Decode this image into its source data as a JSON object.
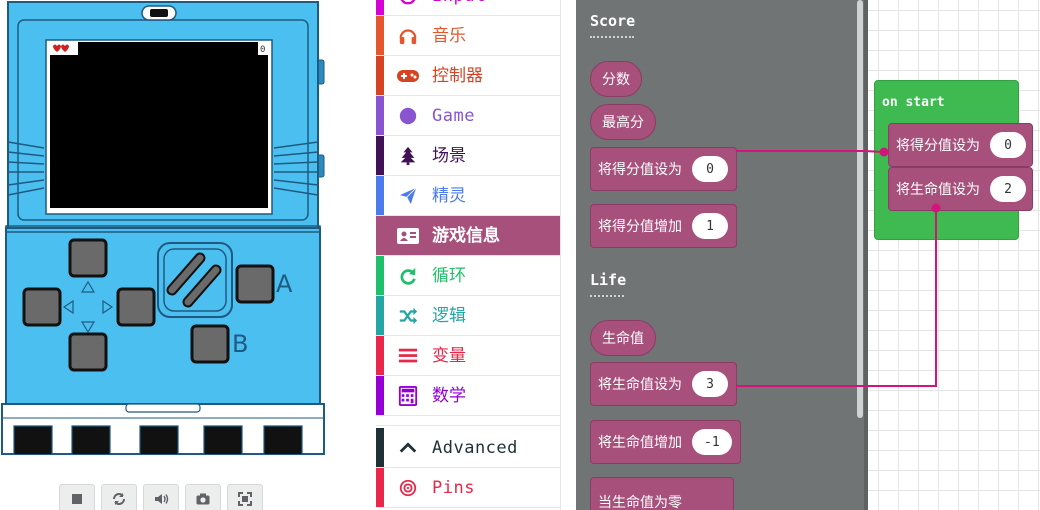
{
  "simulator": {
    "score_icon": "hearts-icon",
    "button_a_label": "A",
    "button_b_label": "B",
    "controls": [
      {
        "name": "stop-button",
        "icon": "stop-icon"
      },
      {
        "name": "restart-button",
        "icon": "restart-icon"
      },
      {
        "name": "mute-button",
        "icon": "speaker-icon"
      },
      {
        "name": "screenshot-button",
        "icon": "camera-icon"
      },
      {
        "name": "fullscreen-button",
        "icon": "fullscreen-icon"
      }
    ]
  },
  "toolbox": {
    "categories": [
      {
        "label": "Input",
        "color": "#d400d4",
        "icon": "input-icon"
      },
      {
        "label": "音乐",
        "color": "#e4572e",
        "icon": "headphones-icon"
      },
      {
        "label": "控制器",
        "color": "#d54322",
        "icon": "gamepad-icon"
      },
      {
        "label": "Game",
        "color": "#8854d0",
        "icon": "circle-icon"
      },
      {
        "label": "场景",
        "color": "#401255",
        "icon": "tree-icon"
      },
      {
        "label": "精灵",
        "color": "#4b7bec",
        "icon": "paper-plane-icon"
      },
      {
        "label": "游戏信息",
        "color": "#a8507c",
        "icon": "id-card-icon",
        "selected": true
      },
      {
        "label": "循环",
        "color": "#20bf6b",
        "icon": "loop-icon"
      },
      {
        "label": "逻辑",
        "color": "#26a5a5",
        "icon": "shuffle-icon"
      },
      {
        "label": "变量",
        "color": "#e8274a",
        "icon": "variables-icon"
      },
      {
        "label": "数学",
        "color": "#9400d3",
        "icon": "calculator-icon"
      }
    ],
    "advanced": [
      {
        "label": "Advanced",
        "color": "#1f3136",
        "icon": "chevron-up-icon"
      },
      {
        "label": "Pins",
        "color": "#e8274a",
        "icon": "target-icon"
      }
    ]
  },
  "flyout": {
    "score_heading": "Score",
    "life_heading": "Life",
    "blocks": {
      "score": "分数",
      "high_score": "最高分",
      "set_score": "将得分值设为",
      "set_score_value": "0",
      "change_score": "将得分值增加",
      "change_score_value": "1",
      "life": "生命值",
      "set_life": "将生命值设为",
      "set_life_value": "3",
      "change_life": "将生命值增加",
      "change_life_value": "-1",
      "on_life_zero": "当生命值为零"
    }
  },
  "workspace": {
    "on_start": "on start",
    "set_score": "将得分值设为",
    "set_score_value": "0",
    "set_life": "将生命值设为",
    "set_life_value": "2"
  },
  "colors": {
    "info_category": "#a8507c",
    "device_body": "#4bc0f0",
    "flyout_bg": "#717475",
    "on_start": "#3eba51",
    "wire": "#d4147a"
  }
}
